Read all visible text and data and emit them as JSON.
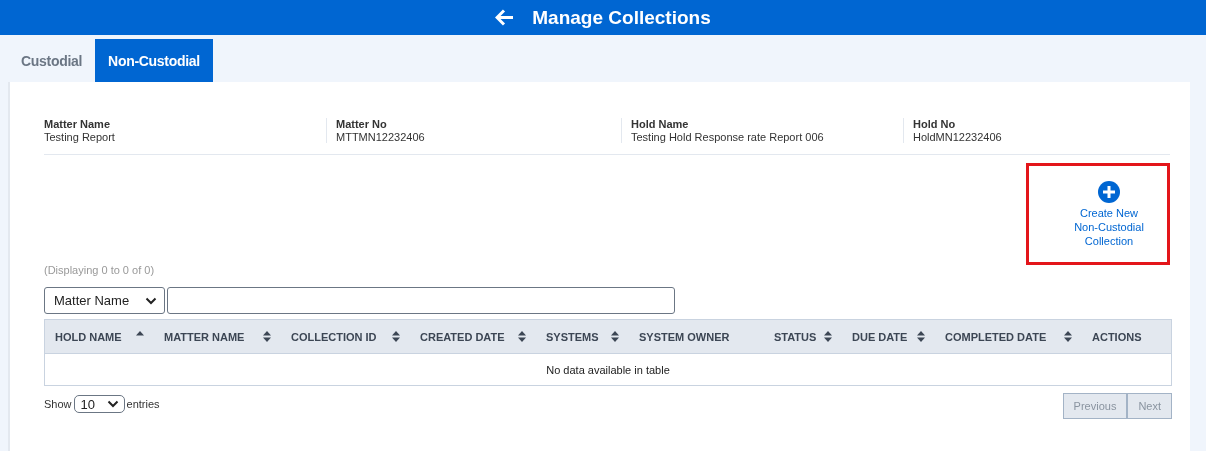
{
  "header": {
    "title": "Manage Collections"
  },
  "tabs": [
    {
      "label": "Custodial",
      "selected": false
    },
    {
      "label": "Non-Custodial",
      "selected": true
    }
  ],
  "info": [
    {
      "label": "Matter Name",
      "value": "Testing Report"
    },
    {
      "label": "Matter No",
      "value": "MTTMN12232406"
    },
    {
      "label": "Hold Name",
      "value": "Testing Hold Response rate Report 006"
    },
    {
      "label": "Hold No",
      "value": "HoldMN12232406"
    }
  ],
  "create_button": {
    "label": "Create New Non-Custodial Collection",
    "highlighted": true
  },
  "displaying": "(Displaying 0 to 0 of 0)",
  "search": {
    "field_select": "Matter Name"
  },
  "table": {
    "columns": [
      {
        "label": "HOLD NAME",
        "sortable": true,
        "sorted": true
      },
      {
        "label": "MATTER NAME",
        "sortable": true,
        "sorted": false
      },
      {
        "label": "COLLECTION ID",
        "sortable": true,
        "sorted": false
      },
      {
        "label": "CREATED DATE",
        "sortable": true,
        "sorted": false
      },
      {
        "label": "SYSTEMS",
        "sortable": true,
        "sorted": false
      },
      {
        "label": "SYSTEM OWNER",
        "sortable": false
      },
      {
        "label": "STATUS",
        "sortable": true,
        "sorted": false
      },
      {
        "label": "DUE DATE",
        "sortable": true,
        "sorted": false
      },
      {
        "label": "COMPLETED DATE",
        "sortable": true,
        "sorted": false
      },
      {
        "label": "ACTIONS",
        "sortable": false
      }
    ],
    "empty_message": "No data available in table"
  },
  "length": {
    "prefix": "Show",
    "value": "10",
    "suffix": "entries"
  },
  "pagination": [
    {
      "label": "Previous",
      "disabled": true
    },
    {
      "label": "Next",
      "disabled": true
    }
  ]
}
